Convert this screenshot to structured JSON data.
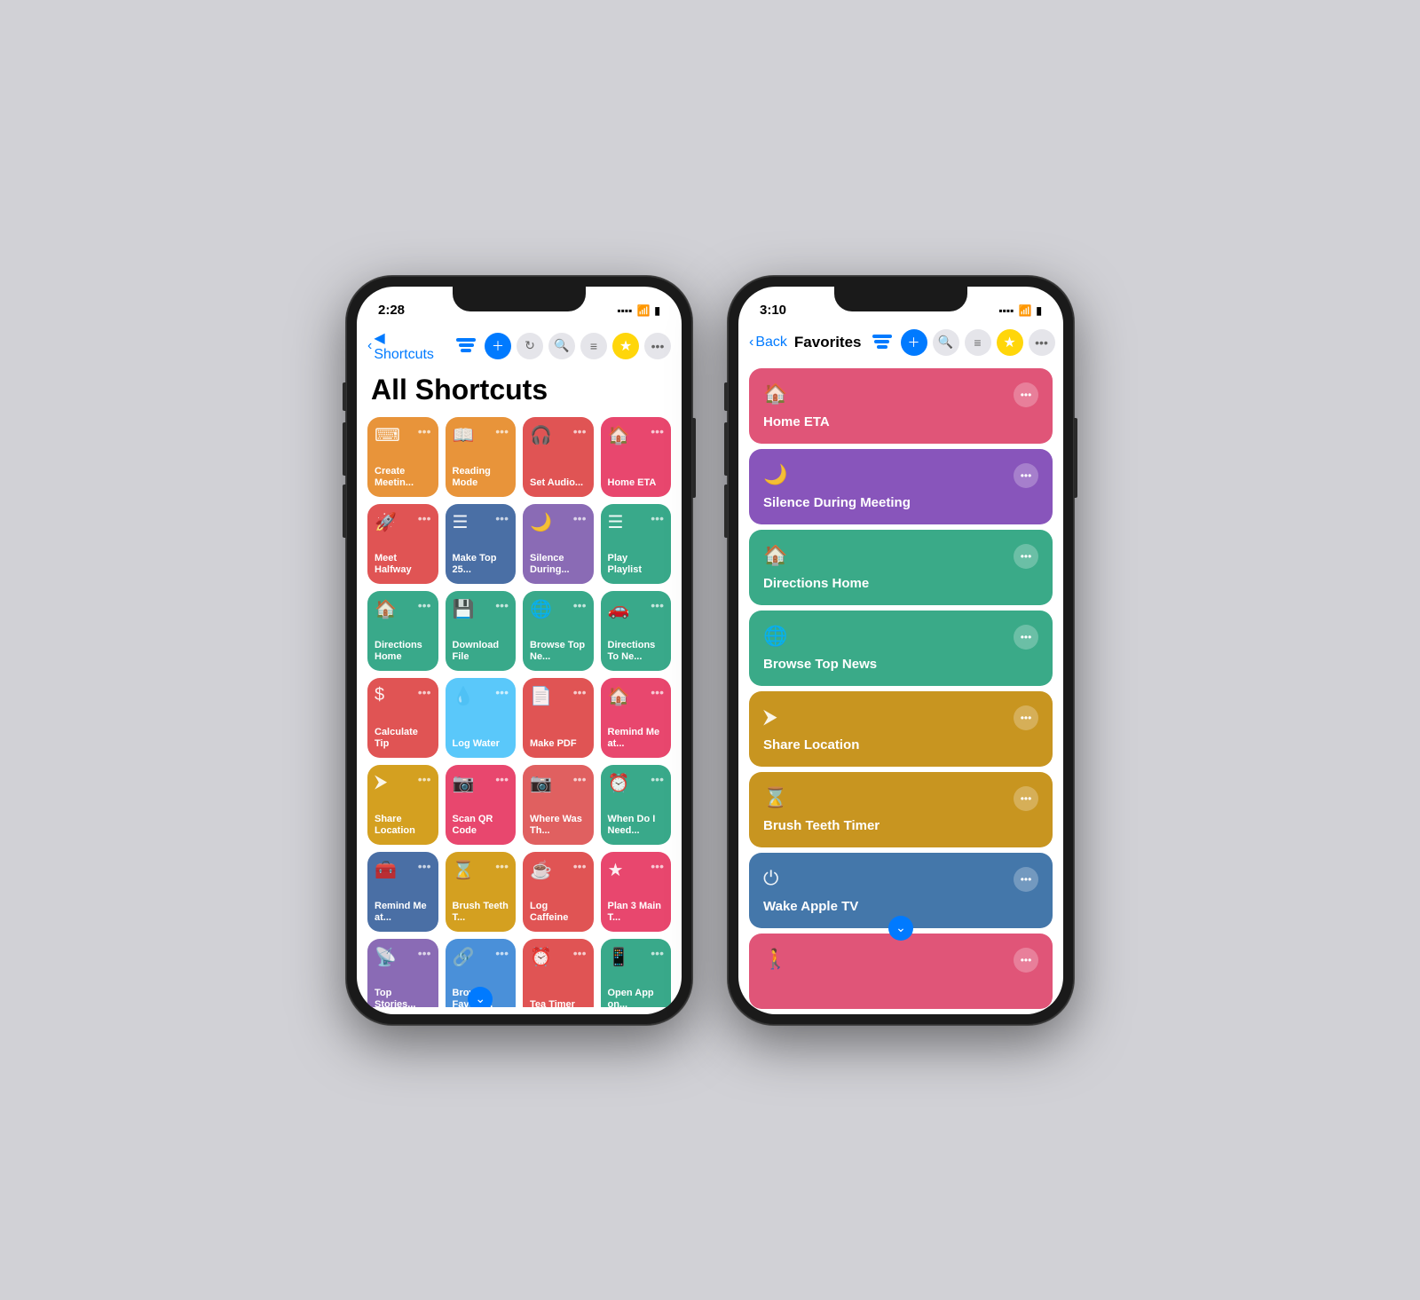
{
  "phone1": {
    "status": {
      "time": "2:28",
      "back_label": "◀ Shortcuts",
      "signal": "▪▪▪▪",
      "wifi": "WiFi",
      "battery": "🔋"
    },
    "nav": {
      "back_icon": "‹",
      "title": "",
      "icons": [
        "layers",
        "add",
        "refresh",
        "search",
        "menu",
        "star",
        "more"
      ]
    },
    "title": "All Shortcuts",
    "tiles": [
      {
        "label": "Create Meetin...",
        "icon": "⌨",
        "color": "c-orange"
      },
      {
        "label": "Reading Mode",
        "icon": "📖",
        "color": "c-orange"
      },
      {
        "label": "Set Audio...",
        "icon": "🎧",
        "color": "c-red"
      },
      {
        "label": "Home ETA",
        "icon": "🏠",
        "color": "c-pink"
      },
      {
        "label": "Meet Halfway",
        "icon": "🚀",
        "color": "c-red"
      },
      {
        "label": "Make Top 25...",
        "icon": "☰",
        "color": "c-blue-dark"
      },
      {
        "label": "Silence During...",
        "icon": "🌙",
        "color": "c-purple"
      },
      {
        "label": "Play Playlist",
        "icon": "☰",
        "color": "c-teal"
      },
      {
        "label": "Directions Home",
        "icon": "🏠",
        "color": "c-teal"
      },
      {
        "label": "Download File",
        "icon": "💾",
        "color": "c-teal"
      },
      {
        "label": "Browse Top Ne...",
        "icon": "🌐",
        "color": "c-teal"
      },
      {
        "label": "Directions To Ne...",
        "icon": "🚗",
        "color": "c-teal"
      },
      {
        "label": "Calculate Tip",
        "icon": "$",
        "color": "c-red"
      },
      {
        "label": "Log Water",
        "icon": "💧",
        "color": "c-blue-light"
      },
      {
        "label": "Make PDF",
        "icon": "📄",
        "color": "c-red"
      },
      {
        "label": "Remind Me at...",
        "icon": "🏠",
        "color": "c-pink"
      },
      {
        "label": "Share Location",
        "icon": "➤",
        "color": "c-amber"
      },
      {
        "label": "Scan QR Code",
        "icon": "📷",
        "color": "c-pink"
      },
      {
        "label": "Where Was Th...",
        "icon": "📷",
        "color": "c-coral"
      },
      {
        "label": "When Do I Need...",
        "icon": "⏰",
        "color": "c-teal"
      },
      {
        "label": "Remind Me at...",
        "icon": "🧳",
        "color": "c-blue-dark"
      },
      {
        "label": "Brush Teeth T...",
        "icon": "⏳",
        "color": "c-amber"
      },
      {
        "label": "Log Caffeine",
        "icon": "☕",
        "color": "c-red"
      },
      {
        "label": "Plan 3 Main T...",
        "icon": "⭐",
        "color": "c-pink"
      },
      {
        "label": "Top Stories...",
        "icon": "📡",
        "color": "c-purple"
      },
      {
        "label": "Browse Favorit...",
        "icon": "🔗",
        "color": "c-blue"
      },
      {
        "label": "Tea Timer",
        "icon": "⏰",
        "color": "c-red"
      },
      {
        "label": "Open App on...",
        "icon": "📱",
        "color": "c-teal"
      }
    ]
  },
  "phone2": {
    "status": {
      "time": "3:10",
      "back_label": "Back",
      "signal": "▪▪▪▪",
      "wifi": "WiFi",
      "battery": "🔋"
    },
    "nav": {
      "back_icon": "‹",
      "title": "Favorites",
      "icons": [
        "layers",
        "add",
        "search",
        "menu",
        "star",
        "more"
      ]
    },
    "favorites": [
      {
        "label": "Home ETA",
        "icon": "🏠",
        "color": "fc-pink"
      },
      {
        "label": "Silence During Meeting",
        "icon": "🌙",
        "color": "fc-purple"
      },
      {
        "label": "Directions Home",
        "icon": "🏠",
        "color": "fc-teal"
      },
      {
        "label": "Browse Top News",
        "icon": "🌐",
        "color": "fc-teal2"
      },
      {
        "label": "Share Location",
        "icon": "➤",
        "color": "fc-amber"
      },
      {
        "label": "Brush Teeth Timer",
        "icon": "⏳",
        "color": "fc-amber2"
      },
      {
        "label": "Wake Apple TV",
        "icon": "⏻",
        "color": "fc-blue"
      },
      {
        "label": "",
        "icon": "🚶",
        "color": "fc-pink2"
      }
    ],
    "download_badge": "⌄"
  }
}
